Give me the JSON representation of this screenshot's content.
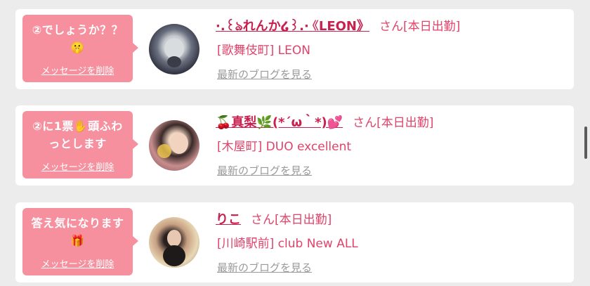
{
  "cards": [
    {
      "message": "②でしょうか？？\n🤫",
      "delete_label": "メッセージを削除",
      "name": "·.꒰ঌれんか໒꒱.·《LEON》",
      "status": "さん[本日出勤]",
      "shop": "[歌舞伎町] LEON",
      "blog_link": "最新のブログを見る"
    },
    {
      "message": "②に1票✋頭ふわ\nっとします",
      "delete_label": "メッセージを削除",
      "name": "🍒真梨🌿(*´ω｀*)💕",
      "status": "さん[本日出勤]",
      "shop": "[木屋町] DUO excellent",
      "blog_link": "最新のブログを見る"
    },
    {
      "message": "答え気になります\n🎁",
      "delete_label": "メッセージを削除",
      "name": "りこ",
      "status": "さん[本日出勤]",
      "shop": "[川崎駅前] club New ALL",
      "blog_link": "最新のブログを見る"
    }
  ],
  "colors": {
    "accent_pink": "#f6909f",
    "name_red": "#c8204f",
    "link_gray": "#9a9a9a"
  }
}
